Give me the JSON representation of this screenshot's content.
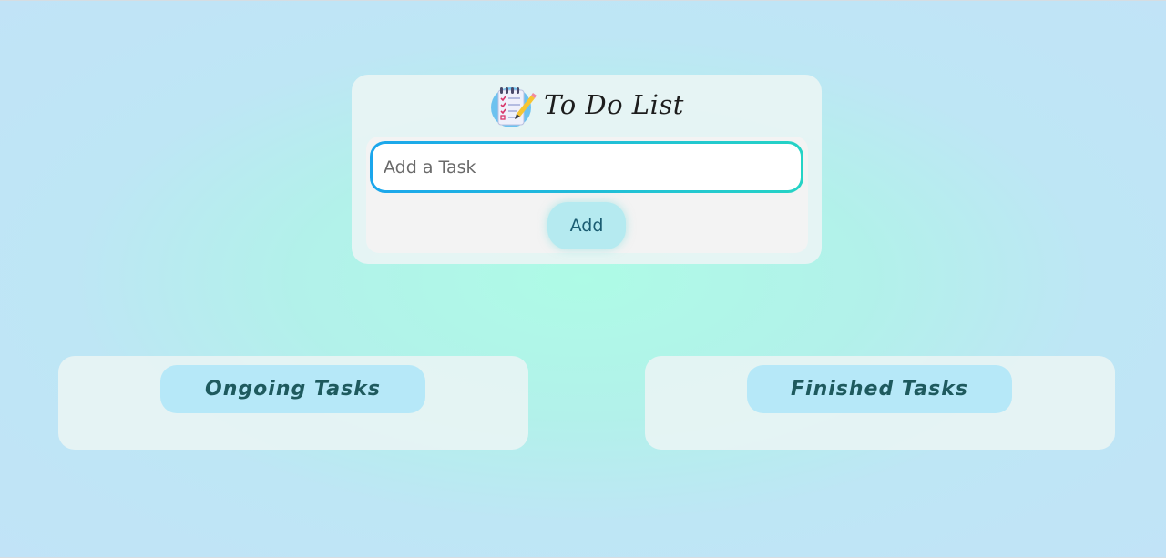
{
  "app": {
    "title": "To Do List",
    "icon": "notepad-icon"
  },
  "task_input": {
    "placeholder": "Add a Task",
    "value": ""
  },
  "add_button": {
    "label": "Add"
  },
  "columns": [
    {
      "heading": "Ongoing Tasks",
      "tasks": []
    },
    {
      "heading": "Finished Tasks",
      "tasks": []
    }
  ],
  "colors": {
    "input_gradient_start": "#1ba6ec",
    "input_gradient_end": "#25d3c5",
    "add_button_bg": "#b5eaf0",
    "heading_bg": "#b6e8f8",
    "heading_text": "#1e5a5e"
  }
}
